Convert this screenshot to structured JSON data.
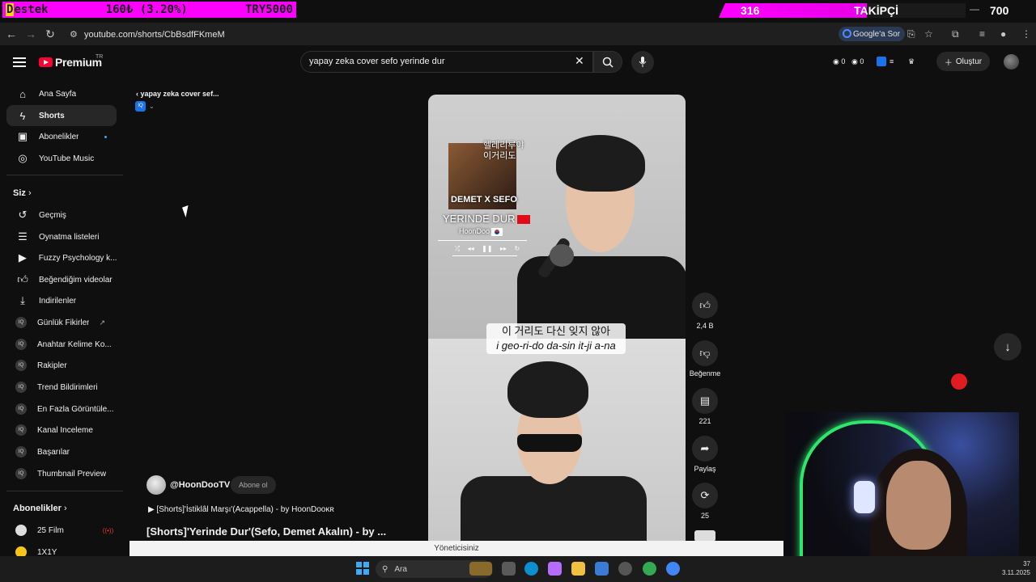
{
  "overlay": {
    "destek_prefix": "D",
    "destek_text": "estek",
    "destek_amount": "160₺ (3.20%)",
    "destek_goal": "TRY5000",
    "followers_current": "316",
    "followers_label": "TAKİPÇİ",
    "followers_goal": "700"
  },
  "browser": {
    "url": "youtube.com/shorts/CbBsdfFKmeM",
    "google_ask": "Google'a Sor"
  },
  "header": {
    "logo_text": "Premium",
    "region": "TR",
    "search_query": "yapay zeka cover sefo yerinde dur",
    "stat1": "0",
    "stat2": "0",
    "create_label": "Oluştur"
  },
  "sidebar": {
    "main": [
      {
        "label": "Ana Sayfa",
        "icon": "home-icon"
      },
      {
        "label": "Shorts",
        "icon": "shorts-icon"
      },
      {
        "label": "Abonelikler",
        "icon": "subscriptions-icon"
      },
      {
        "label": "YouTube Music",
        "icon": "music-icon"
      }
    ],
    "you_heading": "Siz",
    "you": [
      {
        "label": "Geçmiş",
        "icon": "history-icon"
      },
      {
        "label": "Oynatma listeleri",
        "icon": "playlist-icon"
      },
      {
        "label": "Fuzzy Psychology k...",
        "icon": "playlist-play-icon"
      },
      {
        "label": "Beğendiğim videolar",
        "icon": "like-icon"
      },
      {
        "label": "İndirilenler",
        "icon": "download-icon"
      },
      {
        "label": "Günlük Fikirler",
        "icon": "iq-icon"
      },
      {
        "label": "Anahtar Kelime Ko...",
        "icon": "iq-icon"
      },
      {
        "label": "Rakipler",
        "icon": "iq-icon"
      },
      {
        "label": "Trend Bildirimleri",
        "icon": "iq-icon"
      },
      {
        "label": "En Fazla Görüntüle...",
        "icon": "iq-icon"
      },
      {
        "label": "Kanal Inceleme",
        "icon": "iq-icon"
      },
      {
        "label": "Başarılar",
        "icon": "iq-icon"
      },
      {
        "label": "Thumbnail Preview",
        "icon": "iq-icon"
      }
    ],
    "subs_heading": "Abonelikler",
    "subs": [
      {
        "label": "25 Film"
      },
      {
        "label": "1X1Y"
      }
    ]
  },
  "content": {
    "back_query": "yapay zeka cover sef...",
    "iq_badge": "IQ"
  },
  "short": {
    "album_kr_line1": "헬레리루야",
    "album_kr_line2": "이거리도",
    "album_names": "DEMET X SEFO",
    "song_title": "YERINDE DUR",
    "artist": "HoonDoo",
    "subtitle_kr": "이 거리도 다신 잊지 않아",
    "subtitle_roman": "i geo-ri-do da-sin it-ji a-na"
  },
  "actions": {
    "likes": "2,4 B",
    "dislike": "Beğenme",
    "comments": "221",
    "share": "Paylaş",
    "remix": "25"
  },
  "channel": {
    "name": "@HoonDooTV",
    "subscribe": "Abone ol",
    "playlist": "[Shorts]'İstiklâl Marşı'(Acappella) - by HoonDooĸʀ",
    "title": "[Shorts]'Yerinde Dur'(Sefo, Demet Akalın) - by ..."
  },
  "banner": {
    "admin": "Yöneticisiniz"
  },
  "taskbar": {
    "search": "Ara",
    "time": "37",
    "date": "3.11.2025"
  },
  "colors": {
    "overlay_magenta": "#ff00ff",
    "youtube_red": "#ff0033",
    "background": "#0f0f0f"
  }
}
